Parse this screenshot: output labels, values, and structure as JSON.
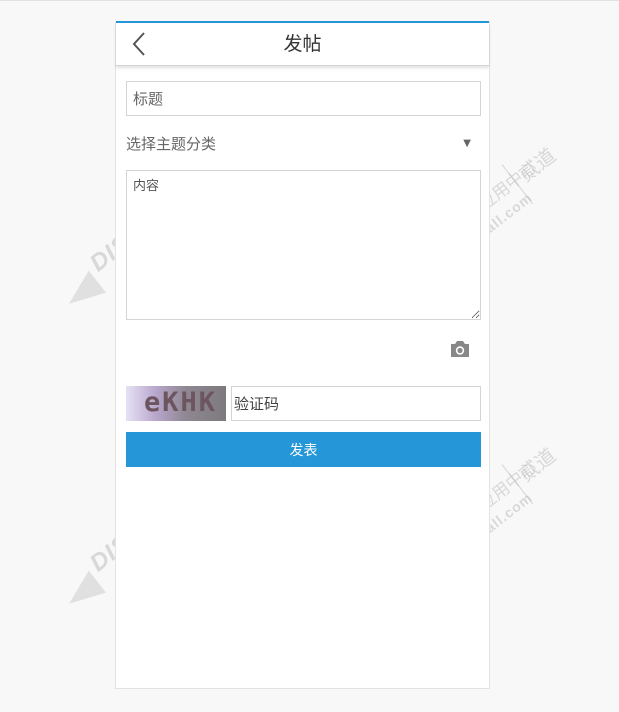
{
  "colors": {
    "accent": "#2597d9",
    "button": "#2597d9"
  },
  "header": {
    "title": "发帖",
    "back_icon": "chevron-left-icon"
  },
  "form": {
    "title_placeholder": "标题",
    "category_label": "选择主题分类",
    "category_caret": "▼",
    "content_placeholder": "内容",
    "camera_icon": "camera-icon",
    "captcha_text": "eKHK",
    "captcha_placeholder": "验证码",
    "submit_label": "发表"
  },
  "watermark": {
    "brand": "DISCUZ!",
    "label": "应用中心",
    "url": "addon.dismall.com",
    "side": "贰道"
  }
}
